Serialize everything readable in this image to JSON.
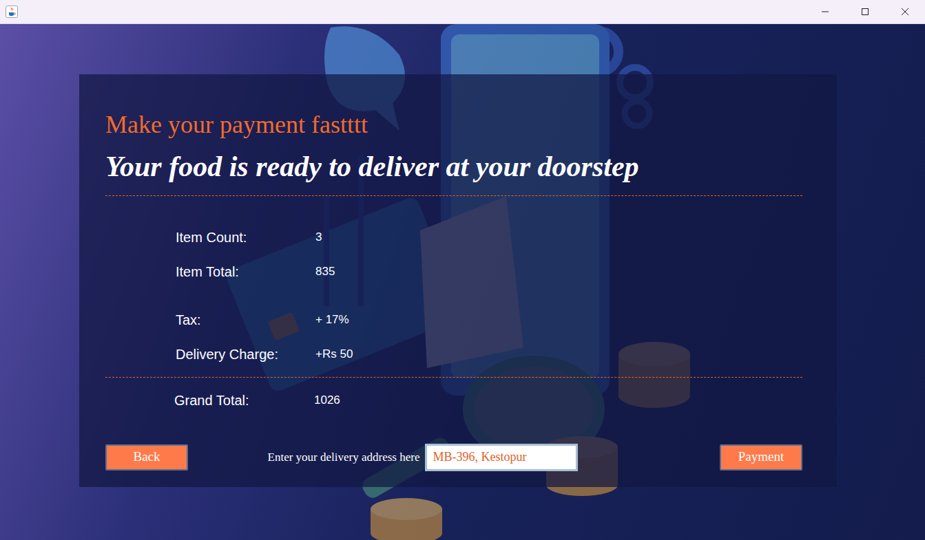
{
  "heading": "Make your payment fastttt",
  "subheading": "Your food is ready to deliver at your doorstep",
  "summary": [
    {
      "label": "Item Count:",
      "value": "3"
    },
    {
      "label": "Item Total:",
      "value": "835"
    },
    {
      "label": "Tax:",
      "value": "+ 17%"
    },
    {
      "label": "Delivery Charge:",
      "value": "+Rs 50"
    }
  ],
  "total": {
    "label": "Grand Total:",
    "value": "1026"
  },
  "back_button": "Back",
  "address": {
    "label": "Enter your delivery address here",
    "value": "MB-396, Kestopur"
  },
  "payment_button": "Payment"
}
